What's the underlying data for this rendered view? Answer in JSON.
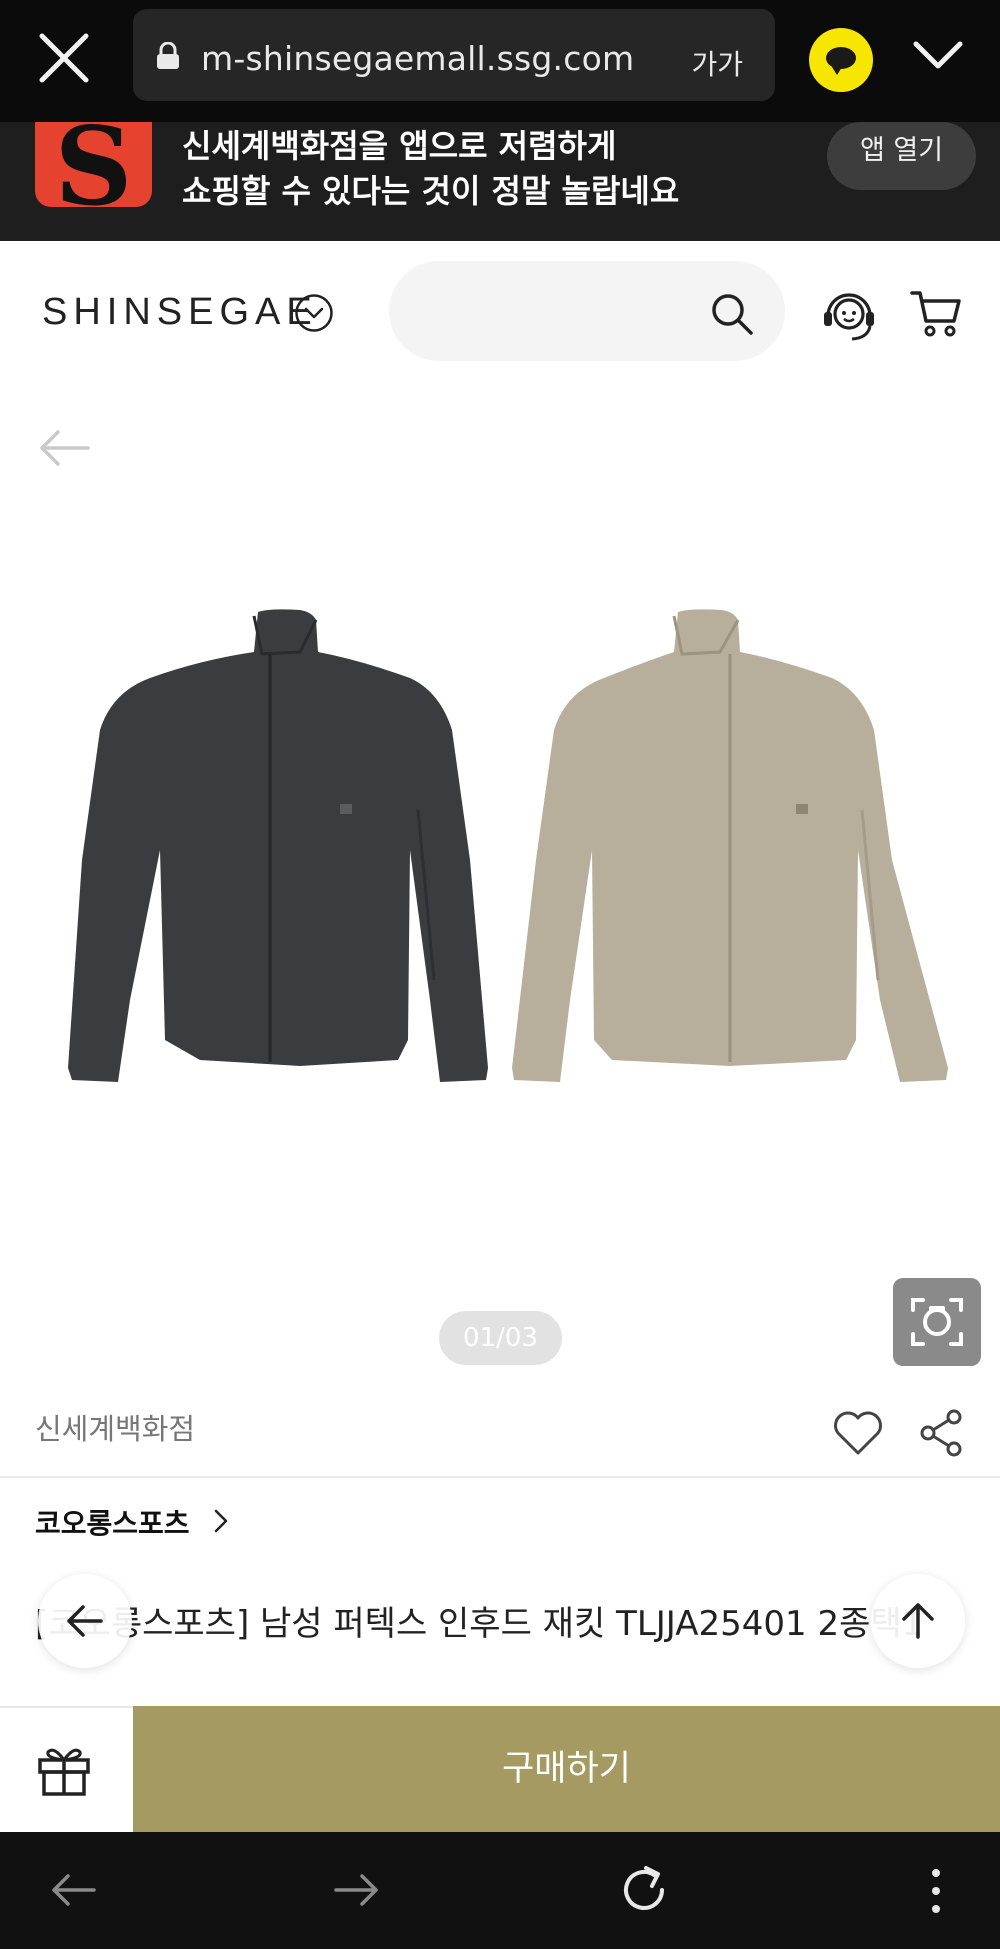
{
  "browser": {
    "url": "m-shinsegaemall.ssg.com",
    "text_size_label": "가가"
  },
  "app_banner": {
    "line1": "신세계백화점을 앱으로 저렴하게",
    "line2": "쇼핑할 수 있다는 것이 정말 놀랍네요",
    "open_label": "앱 열기",
    "logo_letter": "S"
  },
  "header": {
    "brand": "SHINSEGAE",
    "search_placeholder": ""
  },
  "gallery": {
    "counter": "01/03",
    "colors": [
      "#3a3c40",
      "#b7ae9c"
    ]
  },
  "product": {
    "seller": "신세계백화점",
    "brand_link": "코오롱스포츠",
    "title": "[코오롱스포츠] 남성 퍼텍스 인후드 재킷 TLJJA25401 2종택1"
  },
  "action_bar": {
    "buy_label": "구매하기"
  },
  "colors": {
    "buy_button": "#a49a62",
    "kakao": "#f7e600",
    "app_logo": "#e5432f"
  }
}
